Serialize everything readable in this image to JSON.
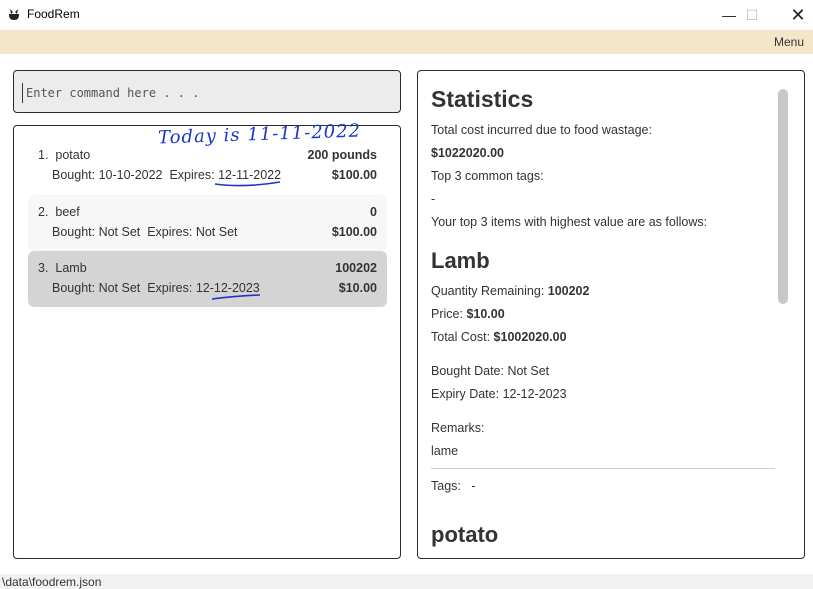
{
  "window": {
    "title": "FoodRem",
    "minimize": "—",
    "maximize": "☐",
    "close": "✕"
  },
  "menubar": {
    "menu_label": "Menu"
  },
  "command": {
    "placeholder": "Enter command here . . ."
  },
  "items": [
    {
      "index": "1.",
      "name": "potato",
      "quantity": "200 pounds",
      "dates": "Bought: 10-10-2022  Expires: 12-11-2022",
      "price": "$100.00"
    },
    {
      "index": "2.",
      "name": "beef",
      "quantity": "0",
      "dates": "Bought: Not Set  Expires: Not Set",
      "price": "$100.00"
    },
    {
      "index": "3.",
      "name": "Lamb",
      "quantity": "100202",
      "dates": "Bought: Not Set  Expires: 12-12-2023",
      "price": "$10.00"
    }
  ],
  "annotation": {
    "today_note": "Today is 11-11-2022"
  },
  "stats": {
    "heading": "Statistics",
    "wastage_label": "Total cost incurred due to food wastage:",
    "wastage_value": "$1022020.00",
    "tags_label": "Top 3 common tags:",
    "tags_value": "-",
    "top_items_label": "Your top 3 items with highest value are as follows:",
    "item1": {
      "name": "Lamb",
      "quantity_label": "Quantity Remaining:",
      "quantity_value": "100202",
      "price_label": "Price:",
      "price_value": "$10.00",
      "total_label": "Total Cost:",
      "total_value": "$1002020.00",
      "bought_label": "Bought Date:",
      "bought_value": "Not Set",
      "expiry_label": "Expiry Date:",
      "expiry_value": "12-12-2023",
      "remarks_label": "Remarks:",
      "remarks_value": "lame",
      "tags_label": "Tags:",
      "tags_value": "-"
    },
    "item2": {
      "name": "potato"
    }
  },
  "status": {
    "path": "\\data\\foodrem.json"
  },
  "colors": {
    "menubar_bg": "#f4e6c9",
    "selected_card": "#d4d4d4",
    "annotation_ink": "#1a36c7"
  }
}
